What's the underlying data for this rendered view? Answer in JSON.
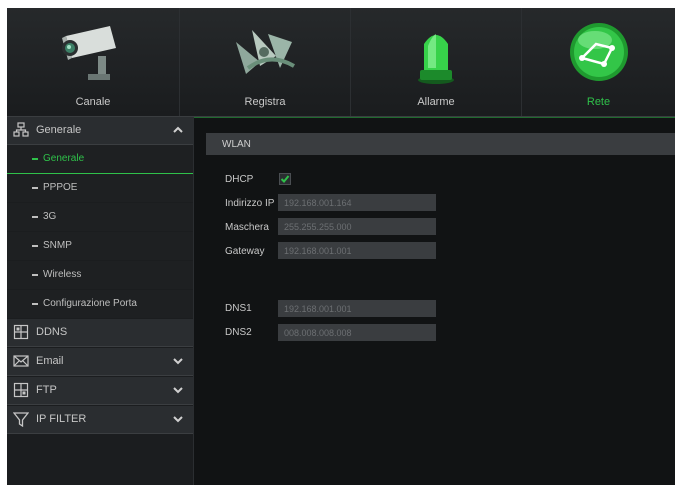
{
  "topnav": {
    "tabs": [
      {
        "label": "Canale",
        "icon": "camera-icon"
      },
      {
        "label": "Registra",
        "icon": "film-reel-icon"
      },
      {
        "label": "Allarme",
        "icon": "alarm-beacon-icon"
      },
      {
        "label": "Rete",
        "icon": "network-globe-icon",
        "active": true
      }
    ]
  },
  "sidebar": {
    "generale": {
      "label": "Generale",
      "icon": "network-icon",
      "expanded": true
    },
    "items": [
      {
        "label": "Generale",
        "active": true
      },
      {
        "label": "PPPOE"
      },
      {
        "label": "3G"
      },
      {
        "label": "SNMP"
      },
      {
        "label": "Wireless"
      },
      {
        "label": "Configurazione Porta"
      }
    ],
    "ddns": {
      "label": "DDNS",
      "icon": "ddns-icon"
    },
    "email": {
      "label": "Email",
      "icon": "envelope-icon"
    },
    "ftp": {
      "label": "FTP",
      "icon": "ftp-icon"
    },
    "ipfilter": {
      "label": "IP FILTER",
      "icon": "filter-icon"
    }
  },
  "content": {
    "section_title": "WLAN",
    "dhcp": {
      "label": "DHCP",
      "checked": true
    },
    "ip": {
      "label": "Indirizzo IP",
      "value": "192.168.001.164"
    },
    "mask": {
      "label": "Maschera",
      "value": "255.255.255.000"
    },
    "gateway": {
      "label": "Gateway",
      "value": "192.168.001.001"
    },
    "dns1": {
      "label": "DNS1",
      "value": "192.168.001.001"
    },
    "dns2": {
      "label": "DNS2",
      "value": "008.008.008.008"
    }
  },
  "colors": {
    "accent": "#2fc14a",
    "background": "#111314",
    "panel": "#1b1d1f"
  }
}
